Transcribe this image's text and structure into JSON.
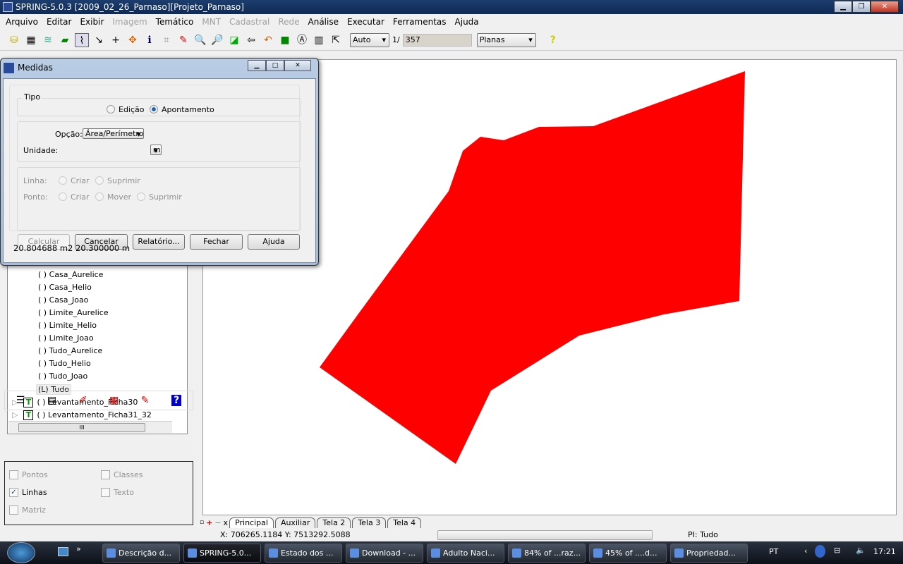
{
  "window": {
    "title": "SPRING-5.0.3 [2009_02_26_Parnaso][Projeto_Parnaso]",
    "minimize": "▁",
    "maximize": "❐",
    "close": "✕"
  },
  "menu": [
    {
      "label": "Arquivo",
      "enabled": true
    },
    {
      "label": "Editar",
      "enabled": true
    },
    {
      "label": "Exibir",
      "enabled": true
    },
    {
      "label": "Imagem",
      "enabled": false
    },
    {
      "label": "Temático",
      "enabled": true
    },
    {
      "label": "MNT",
      "enabled": false
    },
    {
      "label": "Cadastral",
      "enabled": false
    },
    {
      "label": "Rede",
      "enabled": false
    },
    {
      "label": "Análise",
      "enabled": true
    },
    {
      "label": "Executar",
      "enabled": true
    },
    {
      "label": "Ferramentas",
      "enabled": true
    },
    {
      "label": "Ajuda",
      "enabled": true
    }
  ],
  "toolbar": {
    "scale_mode": "Auto",
    "scale_prefix": "1/",
    "scale_value": "357",
    "projection": "Planas",
    "help_glyph": "?"
  },
  "dialog": {
    "title": "Medidas",
    "tipo_label": "Tipo",
    "radio_edicao": "Edição",
    "radio_apontamento": "Apontamento",
    "selected_tipo": "Apontamento",
    "opcao_label": "Opção:",
    "opcao_value": "Área/Perímetro",
    "unidade_label": "Unidade:",
    "unidade_value": "m",
    "linha_label": "Linha:",
    "linha_criar": "Criar",
    "linha_suprimir": "Suprimir",
    "ponto_label": "Ponto:",
    "ponto_criar": "Criar",
    "ponto_mover": "Mover",
    "ponto_suprimir": "Suprimir",
    "buttons": {
      "calcular": "Calcular",
      "cancelar": "Cancelar",
      "relatorio": "Relatório...",
      "fechar": "Fechar",
      "ajuda": "Ajuda"
    },
    "result": "20.804688 m2 20.300000 m"
  },
  "tree": {
    "items": [
      "( ) Casa_Aurelice",
      "( ) Casa_Helio",
      "( ) Casa_Joao",
      "( ) Limite_Aurelice",
      "( ) Limite_Helio",
      "( ) Limite_Joao",
      "( ) Tudo_Aurelice",
      "( ) Tudo_Helio",
      "( ) Tudo_Joao",
      "(L) Tudo"
    ],
    "categories": [
      "( ) Levantamento_Ficha30",
      "( ) Levantamento_Ficha31_32"
    ],
    "category_badge": "T"
  },
  "display_options": {
    "pontos": {
      "label": "Pontos",
      "checked": false
    },
    "classes": {
      "label": "Classes",
      "checked": false
    },
    "linhas": {
      "label": "Linhas",
      "checked": true
    },
    "texto": {
      "label": "Texto",
      "checked": false
    },
    "matriz": {
      "label": "Matriz",
      "checked": false
    }
  },
  "canvas": {
    "polygon_color": "#ff0000"
  },
  "tabs": [
    {
      "label": "Principal",
      "active": true
    },
    {
      "label": "Auxiliar"
    },
    {
      "label": "Tela 2"
    },
    {
      "label": "Tela 3"
    },
    {
      "label": "Tela 4"
    }
  ],
  "status": {
    "coords": "X: 706265.1184   Y: 7513292.5088",
    "pi": "PI: Tudo"
  },
  "taskbar": {
    "tasks": [
      "Descrição d...",
      "SPRING-5.0...",
      "Estado dos ...",
      "Download - ...",
      "Adulto Naci...",
      "84% of ...raz...",
      "45% of ....d...",
      "Propriedad..."
    ],
    "active_task": "SPRING-5.0...",
    "language": "PT",
    "clock": "17:21"
  }
}
